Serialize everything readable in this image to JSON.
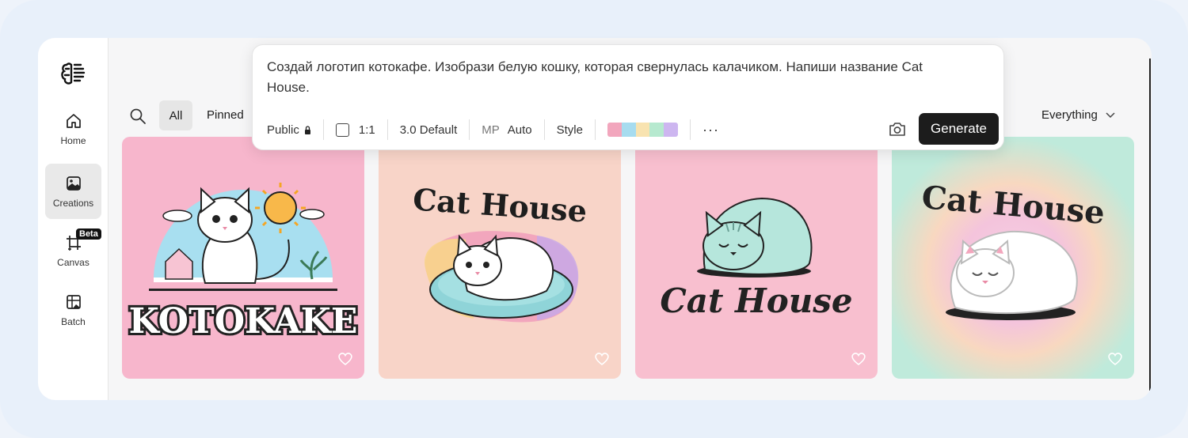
{
  "sidebar": {
    "items": [
      {
        "label": "Home",
        "icon": "home-icon"
      },
      {
        "label": "Creations",
        "icon": "image-icon"
      },
      {
        "label": "Canvas",
        "icon": "crop-icon",
        "badge": "Beta"
      },
      {
        "label": "Batch",
        "icon": "grid-image-icon"
      }
    ]
  },
  "filters": {
    "all": "All",
    "pinned": "Pinned",
    "scope": "Everything"
  },
  "prompt": {
    "text": "Создай логотип котокафе. Изобрази белую кошку, которая свернулась калачиком. Напиши название Cat House.",
    "visibility": "Public",
    "aspect": "1:1",
    "model": "3.0 Default",
    "mp_label": "MP",
    "mp_value": "Auto",
    "style": "Style",
    "more": "···",
    "generate": "Generate",
    "palette": [
      "#f2a6bd",
      "#a7dcef",
      "#f8e3b0",
      "#b6e9cf",
      "#cdb6f0"
    ]
  },
  "cards": [
    {
      "caption": "KOTOKAKE",
      "bg": "#f7b6cc"
    },
    {
      "caption": "Cat House",
      "bg": "#f8d4c8"
    },
    {
      "caption": "Cat House",
      "bg": "#f8bfcf"
    },
    {
      "caption": "Cat House",
      "bg": "#bfeadb"
    }
  ]
}
